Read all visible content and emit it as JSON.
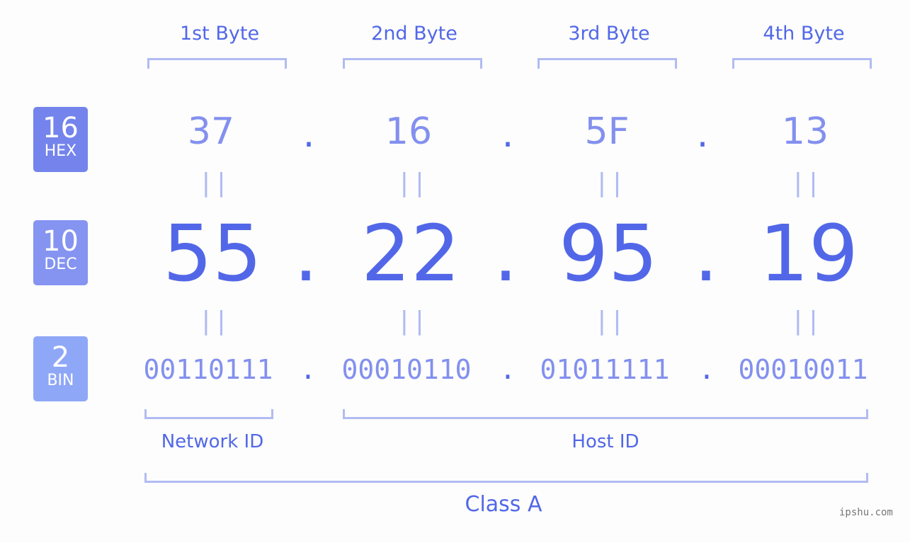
{
  "byte_headers": [
    "1st Byte",
    "2nd Byte",
    "3rd Byte",
    "4th Byte"
  ],
  "badges": {
    "hex": {
      "base": "16",
      "label": "HEX",
      "color": "#7484ec"
    },
    "dec": {
      "base": "10",
      "label": "DEC",
      "color": "#8594f1"
    },
    "bin": {
      "base": "2",
      "label": "BIN",
      "color": "#8fa7f7"
    }
  },
  "hex": [
    "37",
    "16",
    "5F",
    "13"
  ],
  "dec": [
    "55",
    "22",
    "95",
    "19"
  ],
  "bin": [
    "00110111",
    "00010110",
    "01011111",
    "00010011"
  ],
  "separator": ".",
  "equals_sign": "||",
  "parts": {
    "network": "Network ID",
    "host": "Host ID",
    "class": "Class A"
  },
  "watermark": "ipshu.com"
}
